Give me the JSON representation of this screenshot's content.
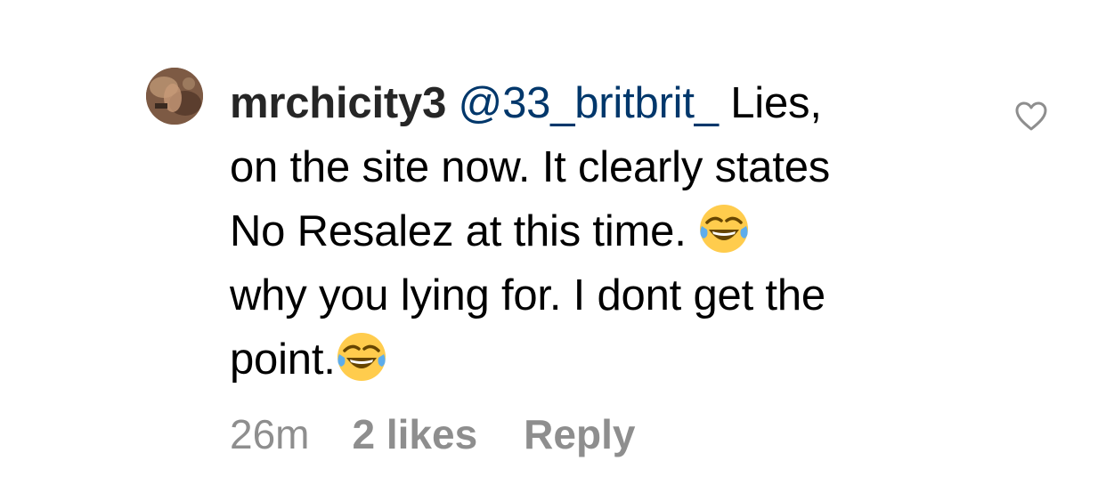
{
  "comment": {
    "username": "mrchicity3",
    "mention": "@33_britbrit_",
    "lines": [
      " Lies,",
      "on the site now. It clearly states",
      "No Resalez at this time. ",
      "why you lying for. I dont get the",
      "point."
    ],
    "emoji_icon": "face-with-tears-of-joy"
  },
  "meta": {
    "time": "26m",
    "likes": "2 likes",
    "reply": "Reply"
  },
  "colors": {
    "username": "#262626",
    "mention": "#00376b",
    "meta": "#8e8e8e",
    "like_icon": "#8e8e8e"
  }
}
